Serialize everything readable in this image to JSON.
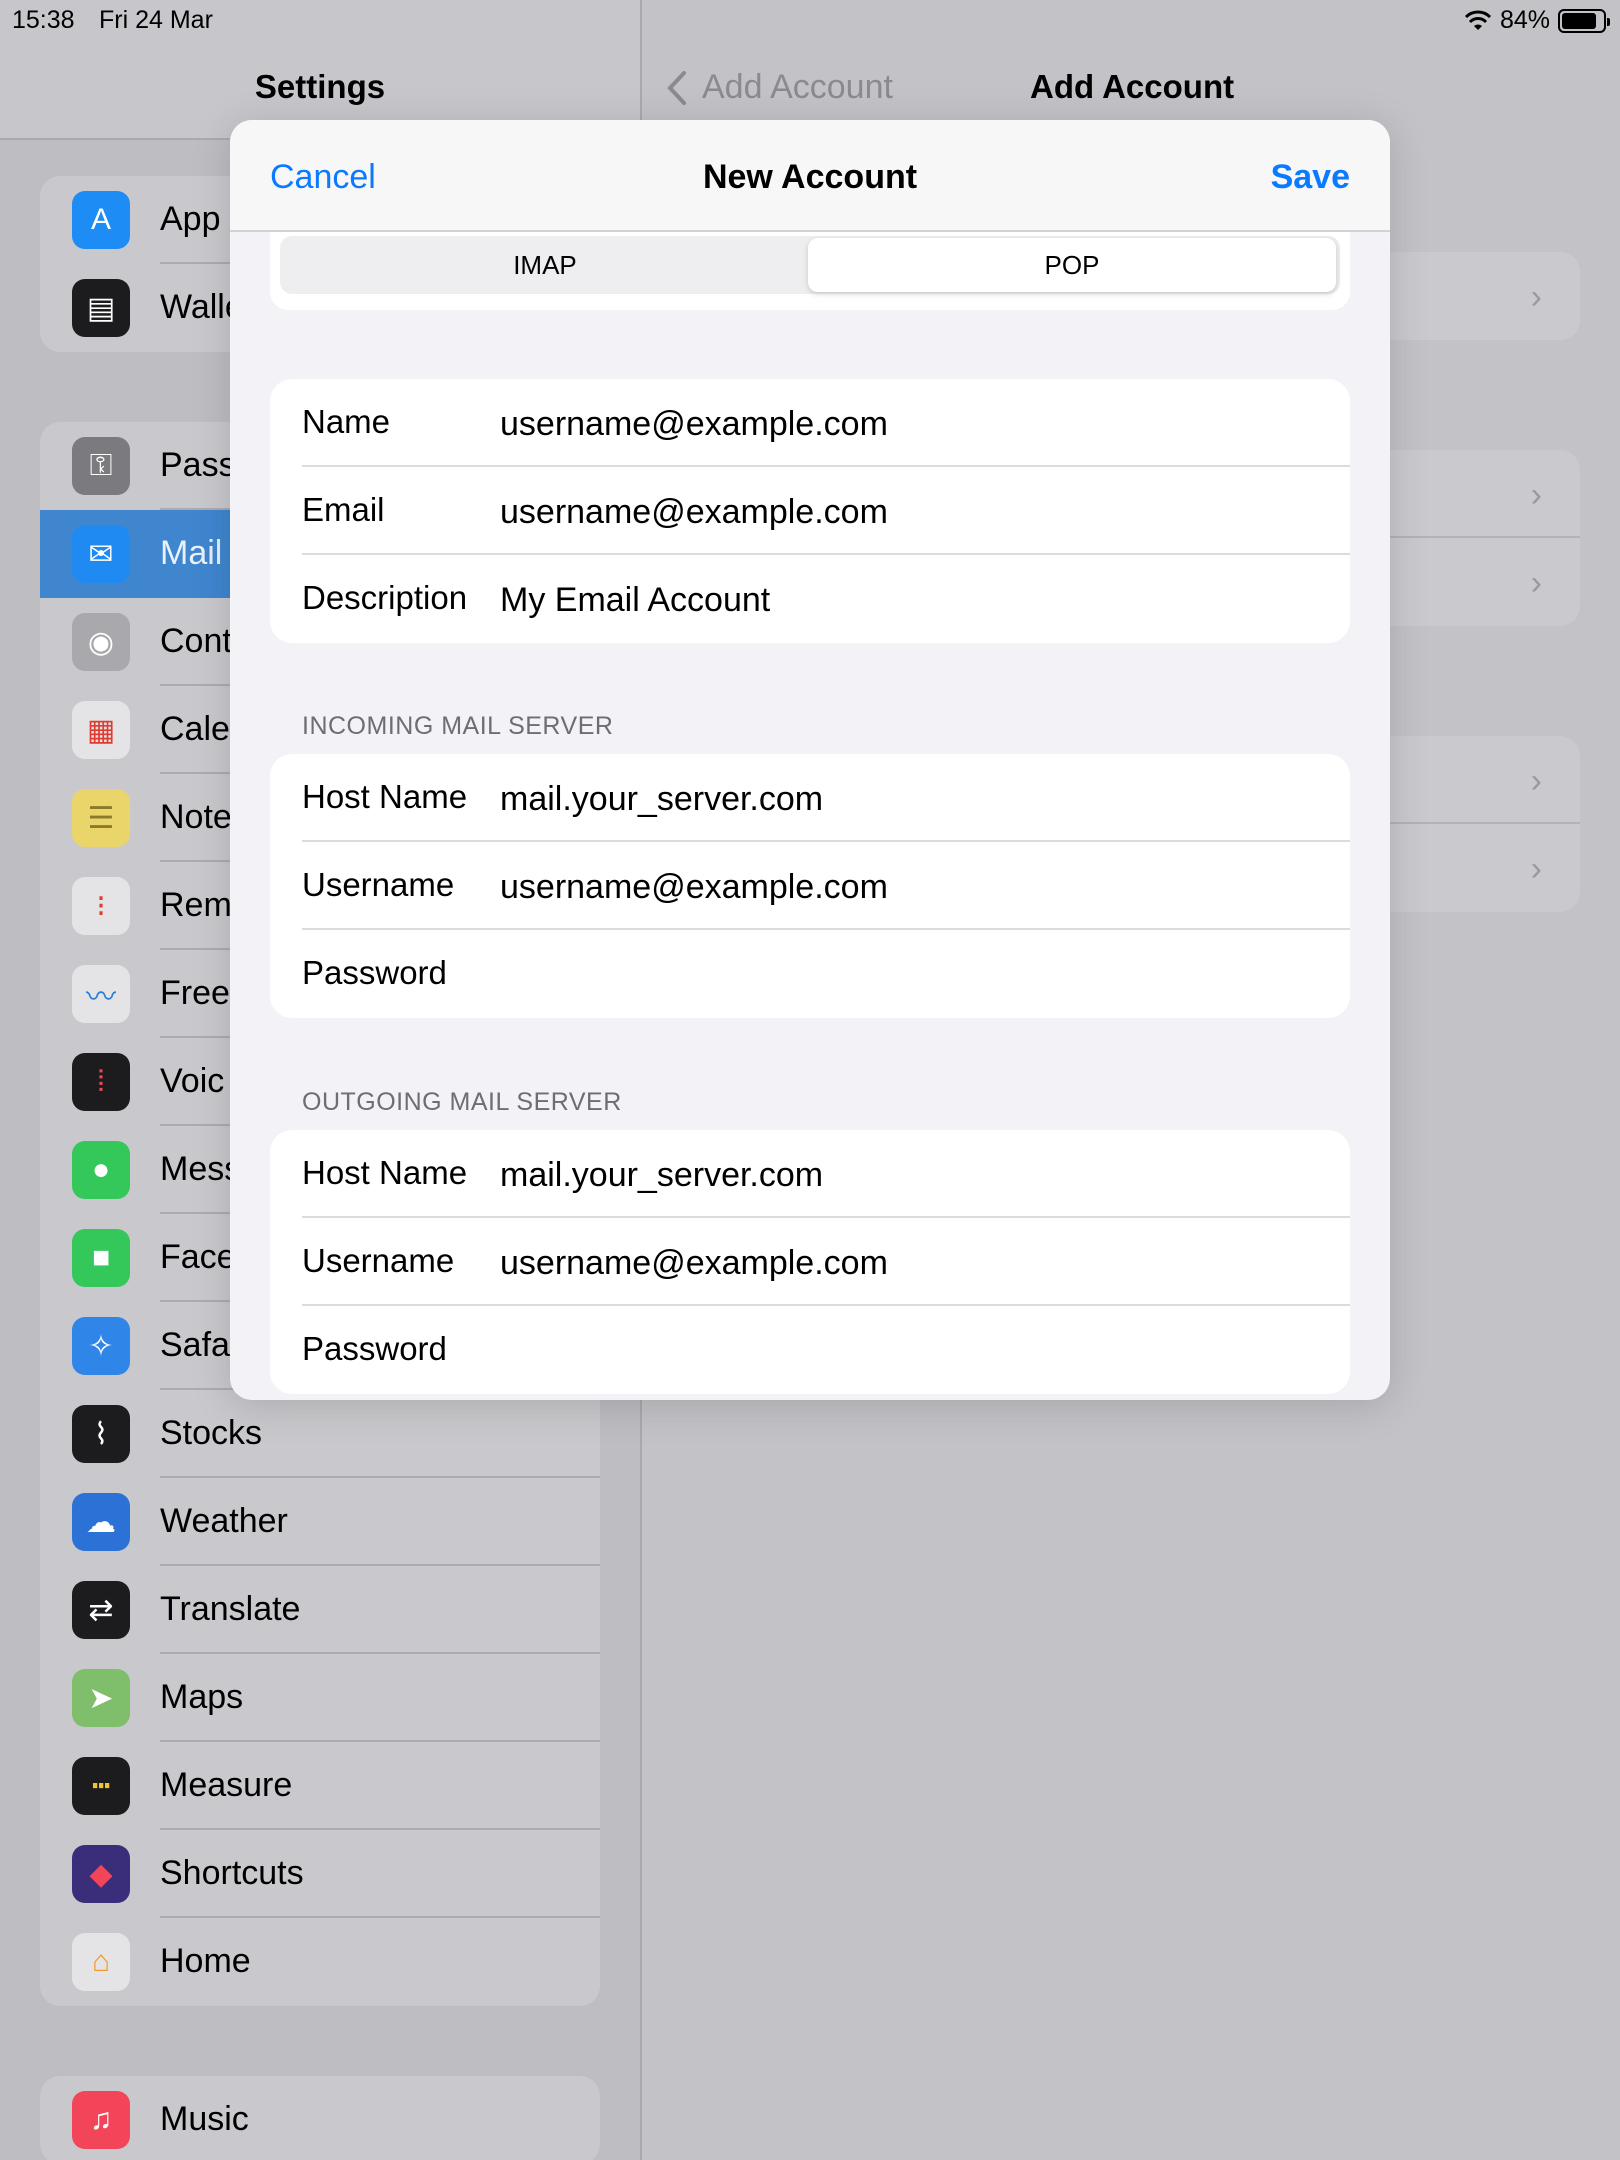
{
  "status_bar": {
    "time": "15:38",
    "date": "Fri 24 Mar",
    "battery": "84%",
    "battery_level": 0.84
  },
  "settings": {
    "title": "Settings",
    "groups": [
      {
        "items": [
          {
            "label": "App",
            "icon": "app-store-icon",
            "color": "#1d8cf5"
          },
          {
            "label": "Walle",
            "icon": "wallet-icon",
            "color": "#1c1c1e"
          }
        ]
      },
      {
        "items": [
          {
            "label": "Pass",
            "icon": "key-icon",
            "color": "#7b7b7f"
          },
          {
            "label": "Mail",
            "icon": "mail-icon",
            "color": "#1f8af2",
            "selected": true
          },
          {
            "label": "Cont",
            "icon": "contacts-icon",
            "color": "#a9a9ad"
          },
          {
            "label": "Cale",
            "icon": "calendar-icon",
            "color": "#e4e4e6"
          },
          {
            "label": "Note",
            "icon": "notes-icon",
            "color": "#e9d56a"
          },
          {
            "label": "Rem",
            "icon": "reminders-icon",
            "color": "#e4e4e6"
          },
          {
            "label": "Free",
            "icon": "freeform-icon",
            "color": "#e4e4e6"
          },
          {
            "label": "Voic",
            "icon": "voice-memos-icon",
            "color": "#1c1c1e"
          },
          {
            "label": "Mess",
            "icon": "messages-icon",
            "color": "#34c759"
          },
          {
            "label": "Face",
            "icon": "facetime-icon",
            "color": "#34c759"
          },
          {
            "label": "Safa",
            "icon": "safari-icon",
            "color": "#2f86e8"
          },
          {
            "label": "Stocks",
            "icon": "stocks-icon",
            "color": "#1c1c1e"
          },
          {
            "label": "Weather",
            "icon": "weather-icon",
            "color": "#2c71d6"
          },
          {
            "label": "Translate",
            "icon": "translate-icon",
            "color": "#1c1c1e"
          },
          {
            "label": "Maps",
            "icon": "maps-icon",
            "color": "#7fbf6b"
          },
          {
            "label": "Measure",
            "icon": "measure-icon",
            "color": "#1c1c1e"
          },
          {
            "label": "Shortcuts",
            "icon": "shortcuts-icon",
            "color": "#3a2d7a"
          },
          {
            "label": "Home",
            "icon": "home-icon",
            "color": "#e4e4e6"
          }
        ]
      },
      {
        "items": [
          {
            "label": "Music",
            "icon": "music-icon",
            "color": "#f2455a"
          }
        ]
      }
    ]
  },
  "detail": {
    "back_label": "Add Account",
    "title": "Add Account"
  },
  "modal": {
    "cancel": "Cancel",
    "title": "New Account",
    "save": "Save",
    "segments": [
      "IMAP",
      "POP"
    ],
    "selected_segment": "POP",
    "account": [
      {
        "label": "Name",
        "value": "username@example.com"
      },
      {
        "label": "Email",
        "value": "username@example.com"
      },
      {
        "label": "Description",
        "value": "My Email Account"
      }
    ],
    "incoming": {
      "header": "INCOMING MAIL SERVER",
      "fields": [
        {
          "label": "Host Name",
          "value": "mail.your_server.com"
        },
        {
          "label": "Username",
          "value": "username@example.com"
        },
        {
          "label": "Password",
          "value": ""
        }
      ]
    },
    "outgoing": {
      "header": "OUTGOING MAIL SERVER",
      "fields": [
        {
          "label": "Host Name",
          "value": "mail.your_server.com"
        },
        {
          "label": "Username",
          "value": "username@example.com"
        },
        {
          "label": "Password",
          "value": ""
        }
      ]
    }
  }
}
